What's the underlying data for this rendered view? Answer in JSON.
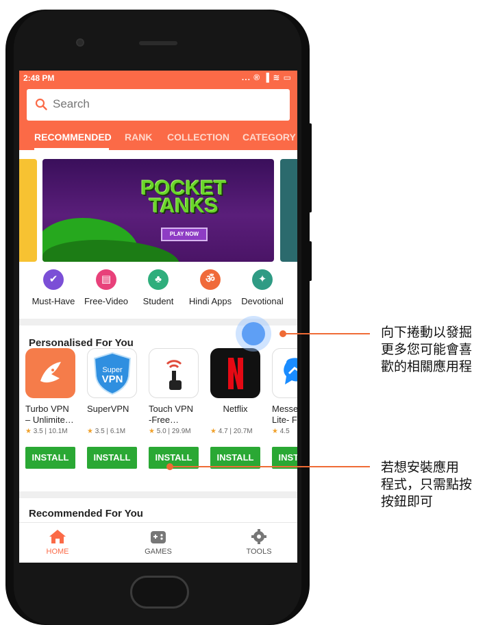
{
  "status": {
    "time": "2:48 PM",
    "icons": "... ® ▐ ≋ ▭"
  },
  "search": {
    "placeholder": "Search"
  },
  "tabs": [
    "RECOMMENDED",
    "RANK",
    "COLLECTION",
    "CATEGORY"
  ],
  "banner": {
    "title": "POCKET TANKS",
    "button": "PLAY NOW"
  },
  "categories": [
    {
      "label": "Must-Have",
      "icon": "check-icon",
      "color": "#7b4fd6"
    },
    {
      "label": "Free-Video",
      "icon": "film-icon",
      "color": "#e8417a"
    },
    {
      "label": "Student",
      "icon": "student-icon",
      "color": "#2fae7c"
    },
    {
      "label": "Hindi Apps",
      "icon": "hindi-icon",
      "color": "#f06a3a"
    },
    {
      "label": "Devotional",
      "icon": "book-icon",
      "color": "#2f9b84"
    }
  ],
  "sections": {
    "personalised": "Personalised For You",
    "recommended": "Recommended For You"
  },
  "apps": [
    {
      "name": "Turbo VPN\n– Unlimite…",
      "rating": "3.5",
      "size": "10.1M",
      "install": "INSTALL"
    },
    {
      "name": "SuperVPN",
      "rating": "3.5",
      "size": "6.1M",
      "install": "INSTALL"
    },
    {
      "name": "Touch VPN\n-Free…",
      "rating": "5.0",
      "size": "29.9M",
      "install": "INSTALL"
    },
    {
      "name": "Netflix",
      "rating": "4.7",
      "size": "20.7M",
      "install": "INSTALL"
    },
    {
      "name": "Messe\nLite- F",
      "rating": "4.5",
      "size": "",
      "install": "INSTALL"
    }
  ],
  "nav": [
    {
      "label": "HOME",
      "icon": "home-icon"
    },
    {
      "label": "GAMES",
      "icon": "gamepad-icon"
    },
    {
      "label": "TOOLS",
      "icon": "gear-icon"
    }
  ],
  "callouts": {
    "scroll": "向下捲動以發掘\n更多您可能會喜\n歡的相關應用程",
    "install": "若想安裝應用\n程式，只需點按\n按鈕即可"
  },
  "colors": {
    "accent": "#fb6a47",
    "install_green": "#2aa834",
    "callout": "#ef6b35"
  }
}
